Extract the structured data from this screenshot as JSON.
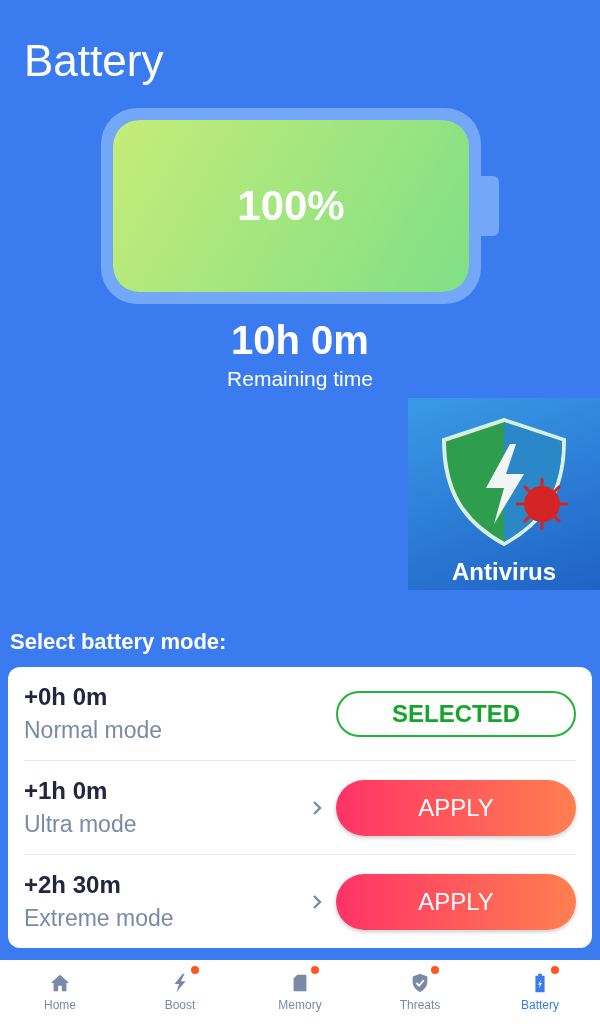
{
  "header": {
    "title": "Battery"
  },
  "battery": {
    "percent": "100%",
    "time": "10h 0m",
    "time_label": "Remaining time"
  },
  "ad": {
    "label": "Antivirus"
  },
  "modes_title": "Select battery mode:",
  "modes": [
    {
      "gain": "+0h 0m",
      "name": "Normal mode",
      "selected": true,
      "button": "SELECTED"
    },
    {
      "gain": "+1h 0m",
      "name": "Ultra mode",
      "selected": false,
      "button": "APPLY"
    },
    {
      "gain": "+2h 30m",
      "name": "Extreme mode",
      "selected": false,
      "button": "APPLY"
    }
  ],
  "nav": [
    {
      "kind": "home",
      "label": "Home",
      "selected": false,
      "badge": false
    },
    {
      "kind": "boost",
      "label": "Boost",
      "selected": false,
      "badge": true
    },
    {
      "kind": "memory",
      "label": "Memory",
      "selected": false,
      "badge": true
    },
    {
      "kind": "threats",
      "label": "Threats",
      "selected": false,
      "badge": true
    },
    {
      "kind": "battery",
      "label": "Battery",
      "selected": true,
      "badge": true
    }
  ]
}
